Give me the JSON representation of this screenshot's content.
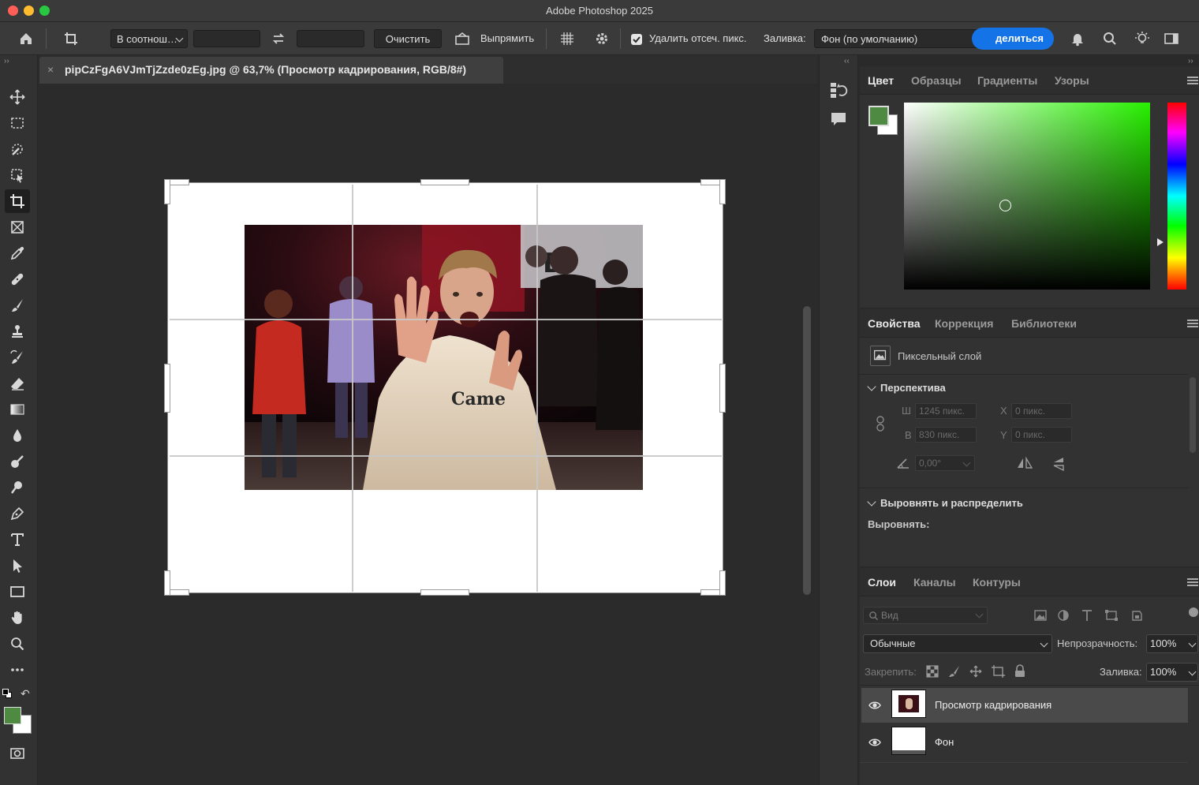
{
  "window": {
    "title": "Adobe Photoshop 2025"
  },
  "options_bar": {
    "ratio_label": "В соотнош…",
    "width_value": "",
    "height_value": "",
    "clear_label": "Очистить",
    "straighten_label": "Выпрямить",
    "delete_cropped_label": "Удалить отсеч. пикс.",
    "delete_cropped_checked": true,
    "fill_label": "Заливка:",
    "fill_value": "Фон (по умолчанию)",
    "share_label": "делиться"
  },
  "document": {
    "tab_title": "pipCzFgA6VJmTjZzde0zEg.jpg @ 63,7% (Просмотр кадрирования, RGB/8#)",
    "zoom": "63,7%"
  },
  "colors": {
    "foreground": "#4f8a43",
    "background": "#ffffff",
    "ui_accent": "#1473e6"
  },
  "color_panel": {
    "tabs": [
      "Цвет",
      "Образцы",
      "Градиенты",
      "Узоры"
    ],
    "active_tab": 0
  },
  "properties_panel": {
    "tabs": [
      "Свойства",
      "Коррекция",
      "Библиотеки"
    ],
    "active_tab": 0,
    "layer_type": "Пиксельный слой",
    "perspective_title": "Перспектива",
    "width_label": "Ш",
    "width_value": "1245 пикс.",
    "height_label": "В",
    "height_value": "830 пикс.",
    "x_label": "X",
    "x_value": "0 пикс.",
    "y_label": "Y",
    "y_value": "0 пикс.",
    "angle_value": "0,00°",
    "align_title": "Выровнять и распределить",
    "align_label": "Выровнять:"
  },
  "layers_panel": {
    "tabs": [
      "Слои",
      "Каналы",
      "Контуры"
    ],
    "active_tab": 0,
    "search_placeholder": "Вид",
    "blend_mode": "Обычные",
    "opacity_label": "Непрозрачность:",
    "opacity_value": "100%",
    "lock_label": "Закрепить:",
    "fill_label": "Заливка:",
    "fill_value": "100%",
    "layers": [
      {
        "name": "Просмотр кадрирования",
        "visible": true,
        "selected": true
      },
      {
        "name": "Фон",
        "visible": true,
        "selected": false
      }
    ]
  }
}
